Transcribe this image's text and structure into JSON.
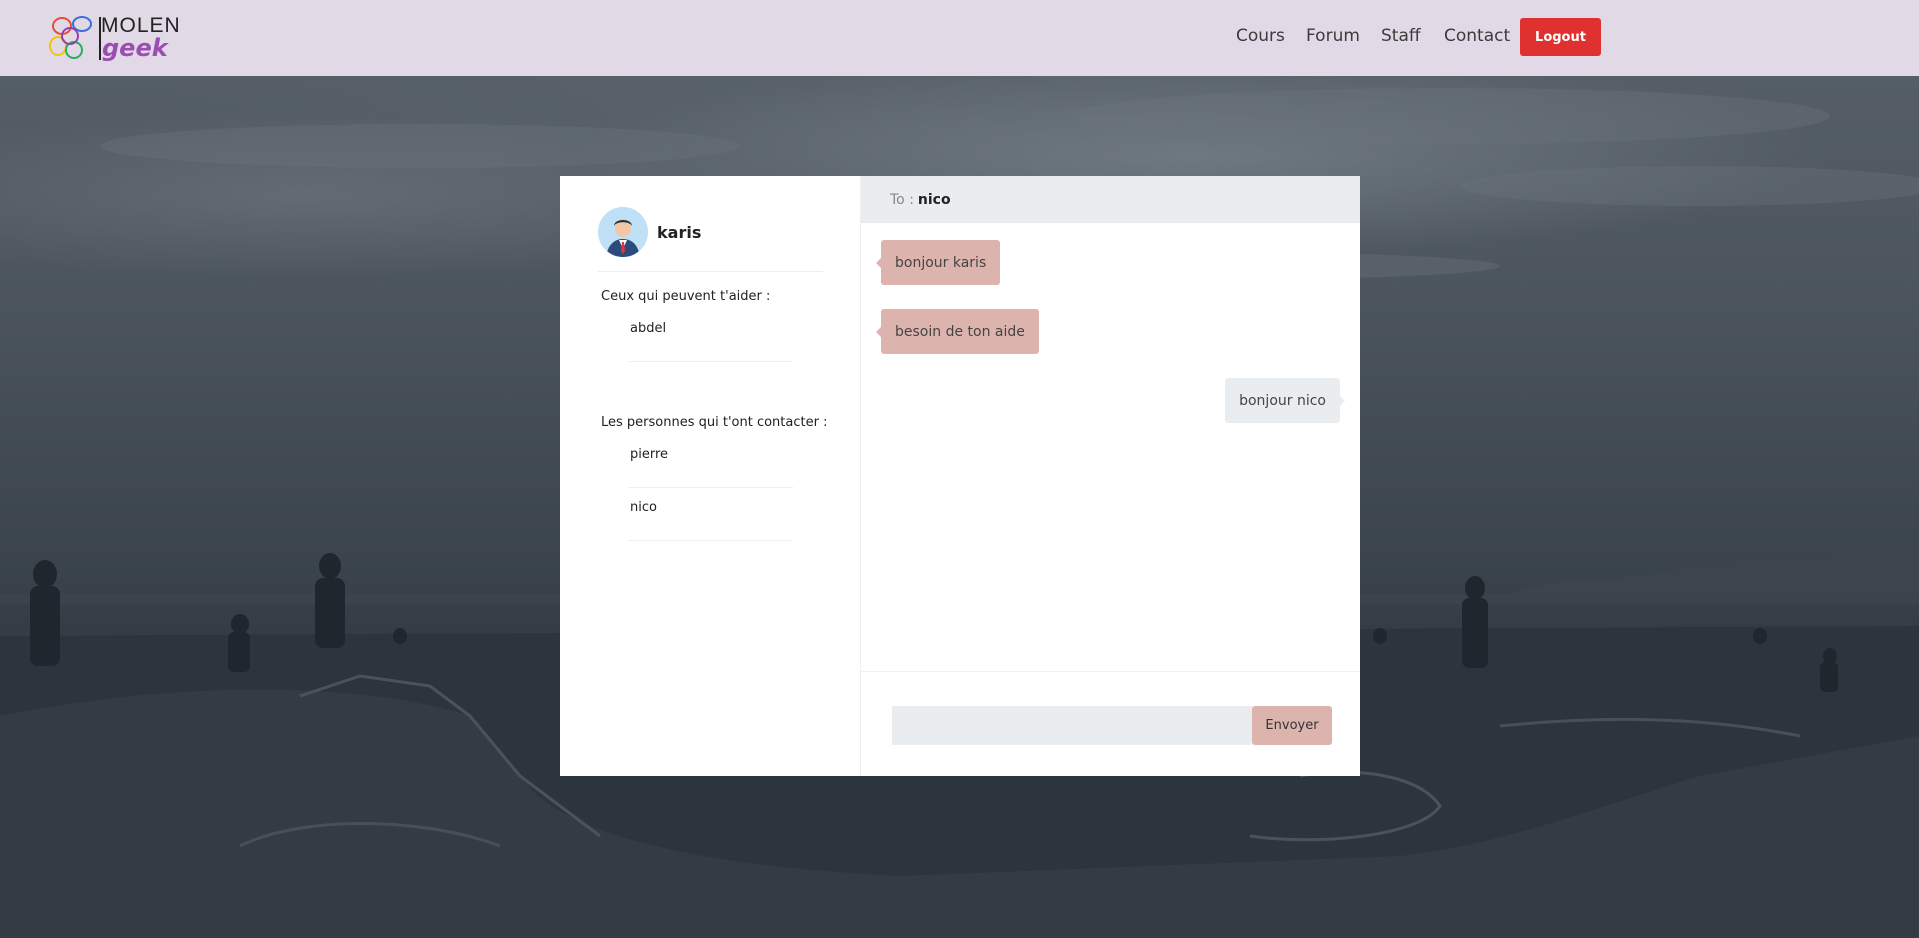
{
  "logo": {
    "text_top": "MOLEN",
    "text_bottom": "geek"
  },
  "nav": {
    "links": [
      "Cours",
      "Forum",
      "Staff",
      "Contact"
    ],
    "logout_label": "Logout",
    "logout_color": "#e03131"
  },
  "profile": {
    "name": "karis",
    "avatar_icon": "user-avatar-icon"
  },
  "helpers": {
    "label": "Ceux qui peuvent t'aider :",
    "items": [
      "abdel"
    ]
  },
  "contacted": {
    "label": "Les personnes qui t'ont contacter :",
    "items": [
      "pierre",
      "nico"
    ]
  },
  "conversation": {
    "to_label": "To :",
    "to_name": "nico",
    "messages": [
      {
        "direction": "in",
        "text": "bonjour karis"
      },
      {
        "direction": "in",
        "text": "besoin de ton aide"
      },
      {
        "direction": "out",
        "text": "bonjour nico"
      }
    ]
  },
  "compose": {
    "input_value": "",
    "send_label": "Envoyer"
  },
  "colors": {
    "navbar_bg": "#e2d9e6",
    "incoming_bubble": "#ddb4ad",
    "outgoing_bubble": "#e9edf0",
    "header_bg": "#e9edf0"
  }
}
